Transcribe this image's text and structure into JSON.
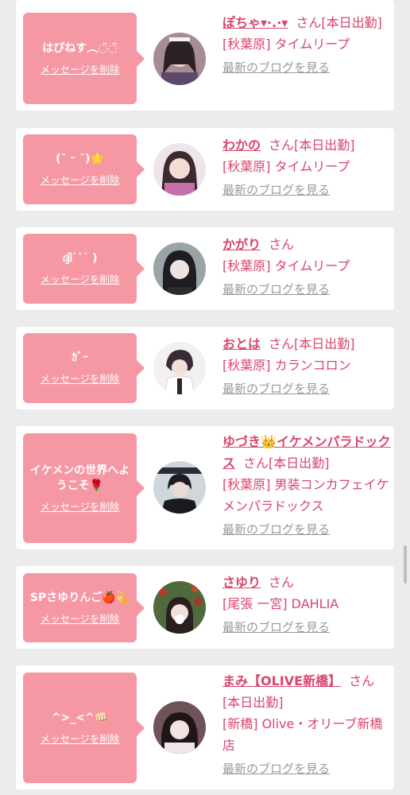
{
  "delete_label": "メッセージを削除",
  "blog_label": "最新のブログを見る",
  "san_label": "さん",
  "items": [
    {
      "message": "はぴねす︵◌̈◌̈",
      "name": "ぽちゃ▾·.·▾",
      "status": "[本日出勤]",
      "shop": "[秋葉原] タイムリープ"
    },
    {
      "message": "(˘ ᵕ ˘)🌟",
      "name": "わかの",
      "status": "[本日出勤]",
      "shop": "[秋葉原] タイムリープ"
    },
    {
      "message": "ദ്ദി˙˘˙ )",
      "name": "かがり",
      "status": "",
      "shop": "[秋葉原] タイムリープ"
    },
    {
      "message": "ｶﾞｰ",
      "name": "おとは",
      "status": "[本日出勤]",
      "shop": "[秋葉原] カランコロン"
    },
    {
      "message": "イケメンの世界へようこそ🌹",
      "name": "ゆづき👑イケメンパラドックス",
      "status": "[本日出勤]",
      "shop": "[秋葉原] 男装コンカフェイケメンパラドックス"
    },
    {
      "message": "SPさゆりんご🍎💫",
      "name": "さゆり",
      "status": "",
      "shop": "[尾張 一宮] DAHLIA"
    },
    {
      "message": "^>_<^👊🏻",
      "name": "まみ【OLIVE新橋】",
      "status": "[本日出勤]",
      "shop": "[新橋] Olive・オリーブ新橋店"
    }
  ],
  "colors": {
    "accent": "#d9456c",
    "bubble": "#f697a4",
    "background": "#ececec",
    "link_gray": "#999999"
  }
}
